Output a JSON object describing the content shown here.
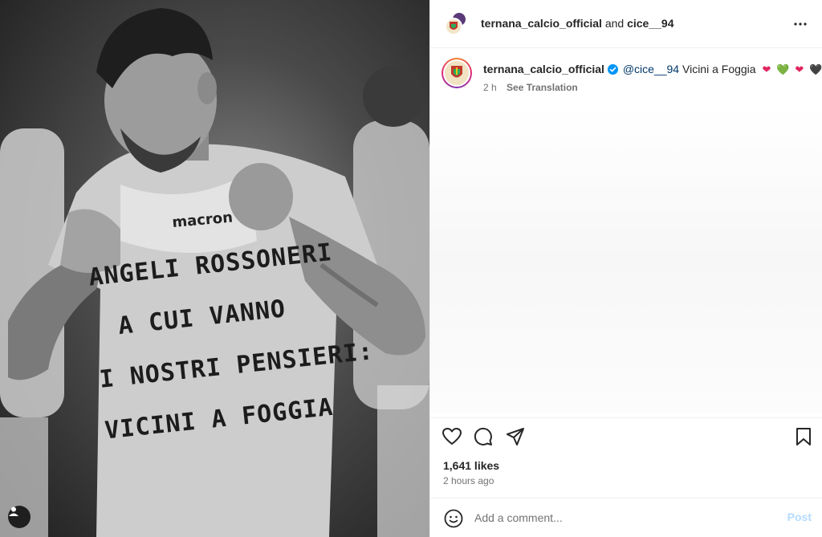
{
  "header": {
    "author": "ternana_calcio_official",
    "joiner": "and",
    "collaborator": "cice__94",
    "more_icon": "more-horizontal-icon"
  },
  "caption": {
    "username": "ternana_calcio_official",
    "mention": "@cice__94",
    "text": "Vicini a Foggia",
    "hearts": [
      "❤",
      "💚",
      "❤",
      "🖤"
    ],
    "heart_colors": [
      "#e0245e",
      "#2ecc71",
      "#e0245e",
      "#111111"
    ],
    "age": "2 h",
    "see_translation": "See Translation"
  },
  "photo": {
    "shirt_lines": [
      "ANGELI ROSSONERI",
      "A CUI VANNO",
      "I NOSTRI PENSIERI:",
      "VICINI A FOGGIA"
    ],
    "chest_text": "macron"
  },
  "actions": {
    "like_icon": "heart-icon",
    "comment_icon": "comment-icon",
    "share_icon": "share-icon",
    "save_icon": "bookmark-icon"
  },
  "stats": {
    "likes": "1,641 likes",
    "posted": "2 hours ago"
  },
  "comment_bar": {
    "placeholder": "Add a comment...",
    "post_label": "Post"
  },
  "colors": {
    "link": "#00376b",
    "muted": "#737373",
    "post_disabled": "#b3dbff",
    "verified": "#0095f6"
  }
}
